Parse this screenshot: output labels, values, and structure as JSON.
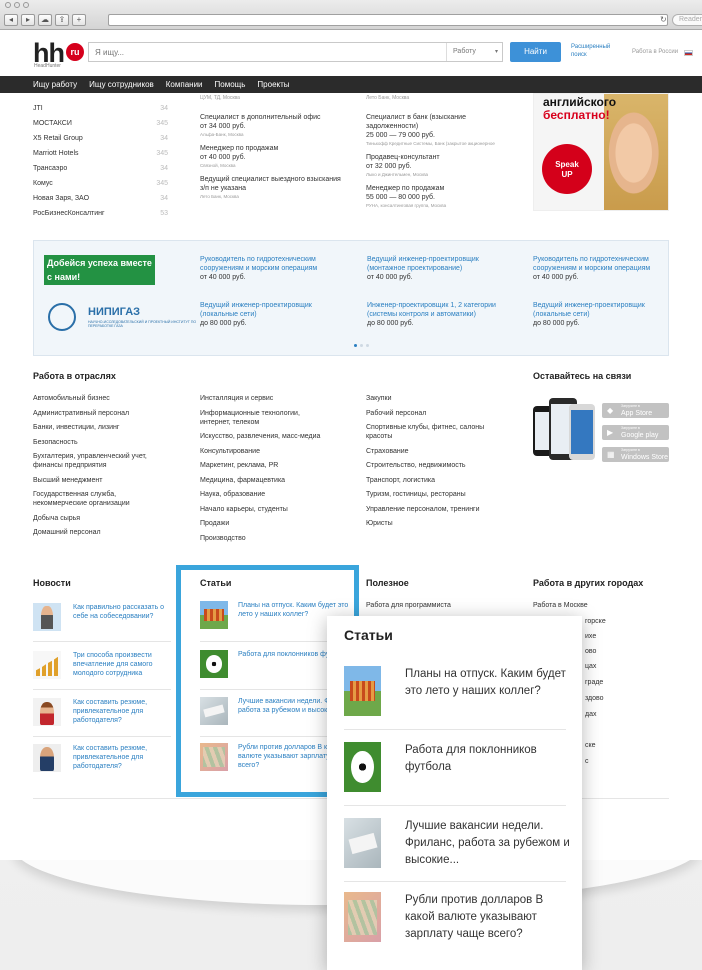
{
  "header": {
    "logo": "hh",
    "logo_badge": "ru",
    "logo_sub": "HeadHunter",
    "search_placeholder": "Я ищу...",
    "search_scope": "Работу",
    "find_button": "Найти",
    "advanced_search": "Расширенный поиск",
    "region": "Работа в России"
  },
  "nav": [
    "Ищу работу",
    "Ищу сотрудников",
    "Компании",
    "Помощь",
    "Проекты"
  ],
  "companies": [
    {
      "name": "JTI",
      "count": "34"
    },
    {
      "name": "МОСТАКСИ",
      "count": "345"
    },
    {
      "name": "X5 Retail Group",
      "count": "34"
    },
    {
      "name": "Marriott Hotels",
      "count": "345"
    },
    {
      "name": "Трансаэро",
      "count": "34"
    },
    {
      "name": "Комус",
      "count": "345"
    },
    {
      "name": "Новая Заря, ЗАО",
      "count": "34"
    },
    {
      "name": "РосБизнесКонсалтинг",
      "count": "53"
    }
  ],
  "jobs_col1": {
    "top_small": "ЦУМ, ТД, Москва",
    "items": [
      {
        "title": "Специалист в дополнительный офис",
        "salary": "от 34 000 руб.",
        "company": "Альфа-Банк, Москва"
      },
      {
        "title": "Менеджер по продажам",
        "salary": "от 40 000 руб.",
        "company": "Связной, Москва"
      },
      {
        "title": "Ведущий специалист выездного взыскания",
        "salary": "з/п не указана",
        "company": "Лето Банк, Москва"
      }
    ]
  },
  "jobs_col2": {
    "top_small": "Лето Банк, Москва",
    "items": [
      {
        "title": "Специалист в банк (взыскание задолженности)",
        "salary": "25 000 — 79 000 руб.",
        "company": "Тинькофф Кредитные Системы, Банк (закрытое акционерное"
      },
      {
        "title": "Продавец-консультант",
        "salary": "от 32 000 руб.",
        "company": "Лыко и Джинтельмен, Москва"
      },
      {
        "title": "Менеджер по продажам",
        "salary": "55 000 — 80 000 руб.",
        "company": "РУНА, консалтинговая группа, Москва"
      }
    ]
  },
  "promo": {
    "line1": "английского",
    "line2": "бесплатно!",
    "badge_top": "Speak",
    "badge_bottom": "UP"
  },
  "ad": {
    "headline_1": "Добейся успеха вместе",
    "headline_2": "с нами!",
    "brand": "НИПИГАЗ",
    "brand_sub": "НАУЧНО-ИССЛЕДОВАТЕЛЬСКИЙ И ПРОЕКТНЫЙ ИНСТИТУТ ПО ПЕРЕРАБОТКЕ ГАЗА",
    "jobs": [
      {
        "title": "Руководитель по гидротехническим сооружениям и морским операциям",
        "salary": "от 40 000 руб."
      },
      {
        "title": "Ведущий инженер-проектировщик (монтажное проектирование)",
        "salary": "от 40 000 руб."
      },
      {
        "title": "Руководитель по гидротехническим сооружениям и морским операциям",
        "salary": "от 40 000 руб."
      },
      {
        "title": "Ведущий инженер-проектировщик (локальные сети)",
        "salary": "до 80 000 руб."
      },
      {
        "title": "Инженер-проектировщик 1, 2 категории (системы контроля и автоматики)",
        "salary": "до 80 000 руб."
      },
      {
        "title": "Ведущий инженер-проектировщик (локальные сети)",
        "salary": "до 80 000 руб."
      }
    ]
  },
  "industries": {
    "title": "Работа в отраслях",
    "col1": [
      "Автомобильный бизнес",
      "Административный персонал",
      "Банки, инвестиции, лизинг",
      "Безопасность",
      "Бухгалтерия, управленческий учет, финансы предприятия",
      "Высший менеджмент",
      "Государственная служба, некоммерческие организации",
      "Добыча сырья",
      "Домашний персонал"
    ],
    "col2": [
      "Инсталляция и сервис",
      "Информационные технологии, интернет, телеком",
      "Искусство, развлечения, масс-медиа",
      "Консультирование",
      "Маркетинг, реклама, PR",
      "Медицина, фармацевтика",
      "Наука, образование",
      "Начало карьеры, студенты",
      "Продажи",
      "Производство"
    ],
    "col3": [
      "Закупки",
      "Рабочий персонал",
      "Спортивные клубы, фитнес, салоны красоты",
      "Страхование",
      "Строительство, недвижимость",
      "Транспорт, логистика",
      "Туризм, гостиницы, рестораны",
      "Управление персоналом, тренинги",
      "Юристы"
    ]
  },
  "stay": {
    "title": "Оставайтесь на связи",
    "stores": [
      {
        "small": "Загрузите в",
        "name": "App Store"
      },
      {
        "small": "Загрузите в",
        "name": "Google play"
      },
      {
        "small": "Загрузите в",
        "name": "Windows Store"
      }
    ]
  },
  "news": {
    "title": "Новости",
    "items": [
      "Как правильно рассказать о себе на собеседовании?",
      "Три способа произвести впечатление для самого молодого сотрудника",
      "Как составить резюме, привлекательное для работодателя?",
      "Как составить резюме, привлекательное для работодателя?"
    ]
  },
  "articles": {
    "title": "Статьи",
    "items": [
      "Планы на отпуск. Каким будет это лето у наших коллег?",
      "Работа для поклонников футбола",
      "Лучшие вакансии недели. Фриланс, работа за рубежом и высокие...",
      "Рубли против долларов В какой валюте указывают зарплату чаще всего?"
    ]
  },
  "useful": {
    "title": "Полезное",
    "first": "Работа для программиста"
  },
  "cities": {
    "title": "Работа в других городах",
    "first": "Работа в Москве",
    "fragments": [
      "горске",
      "ихе",
      "ово",
      "цах",
      "граде",
      "здово",
      "дах",
      "ске",
      "с"
    ]
  },
  "zoom": {
    "title": "Статьи",
    "items": [
      "Планы на отпуск. Каким будет это лето у наших коллег?",
      "Работа для поклонников футбола",
      "Лучшие вакансии недели. Фриланс, работа за рубежом и высокие...",
      "Рубли против долларов В какой валюте указывают зарплату чаще всего?"
    ]
  },
  "browser": {
    "reader": "Reader"
  },
  "colors": {
    "brand_red": "#d6001c",
    "link_blue": "#2a7fc1",
    "accent_blue": "#3aa5dc",
    "button_blue": "#3d91d8",
    "nav_dark": "#2b2b2b",
    "ad_green": "#239243"
  }
}
